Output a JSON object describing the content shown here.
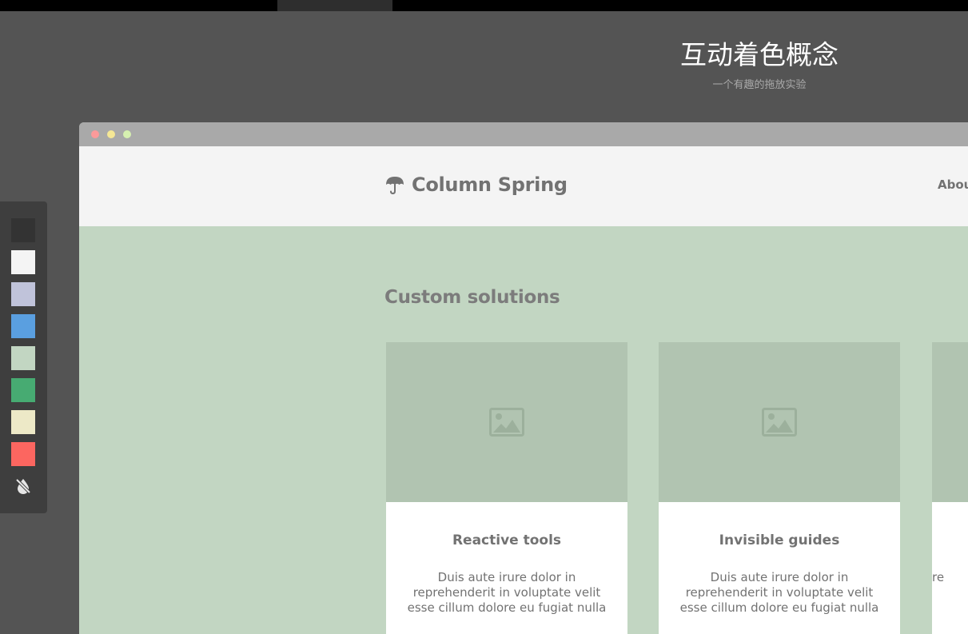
{
  "hero": {
    "title": "互动着色概念",
    "subtitle": "一个有趣的拖放实验"
  },
  "palette": {
    "swatches": [
      {
        "name": "charcoal",
        "color": "#333333"
      },
      {
        "name": "light-gray",
        "color": "#f4f4f4"
      },
      {
        "name": "lavender",
        "color": "#c0c3da"
      },
      {
        "name": "blue",
        "color": "#5a9fe0"
      },
      {
        "name": "sage",
        "color": "#c2d6c2"
      },
      {
        "name": "green",
        "color": "#47ab72"
      },
      {
        "name": "cream",
        "color": "#ede9c7"
      },
      {
        "name": "coral",
        "color": "#fc6660"
      }
    ],
    "toggle_icon": "no-color-drop-icon"
  },
  "browser": {
    "dots": [
      {
        "name": "close",
        "color": "#fb9a9a"
      },
      {
        "name": "minimize",
        "color": "#f5e795"
      },
      {
        "name": "maximize",
        "color": "#d6f0b0"
      }
    ],
    "background_color": "#c2d6c2",
    "header_color": "#f4f4f4"
  },
  "site": {
    "logo_icon": "umbrella-icon",
    "logo_text": "Column Spring",
    "nav": {
      "about": "Abou"
    },
    "section_title": "Custom solutions",
    "cards": [
      {
        "image_icon": "image-placeholder-icon",
        "title": "Reactive tools",
        "text": "Duis aute irure dolor in reprehenderit in voluptate velit esse cillum dolore eu fugiat nulla"
      },
      {
        "image_icon": "image-placeholder-icon",
        "title": "Invisible guides",
        "text": "Duis aute irure dolor in reprehenderit in voluptate velit esse cillum dolore eu fugiat nulla"
      },
      {
        "image_icon": "image-placeholder-icon",
        "title": "",
        "text": "re es"
      }
    ]
  }
}
